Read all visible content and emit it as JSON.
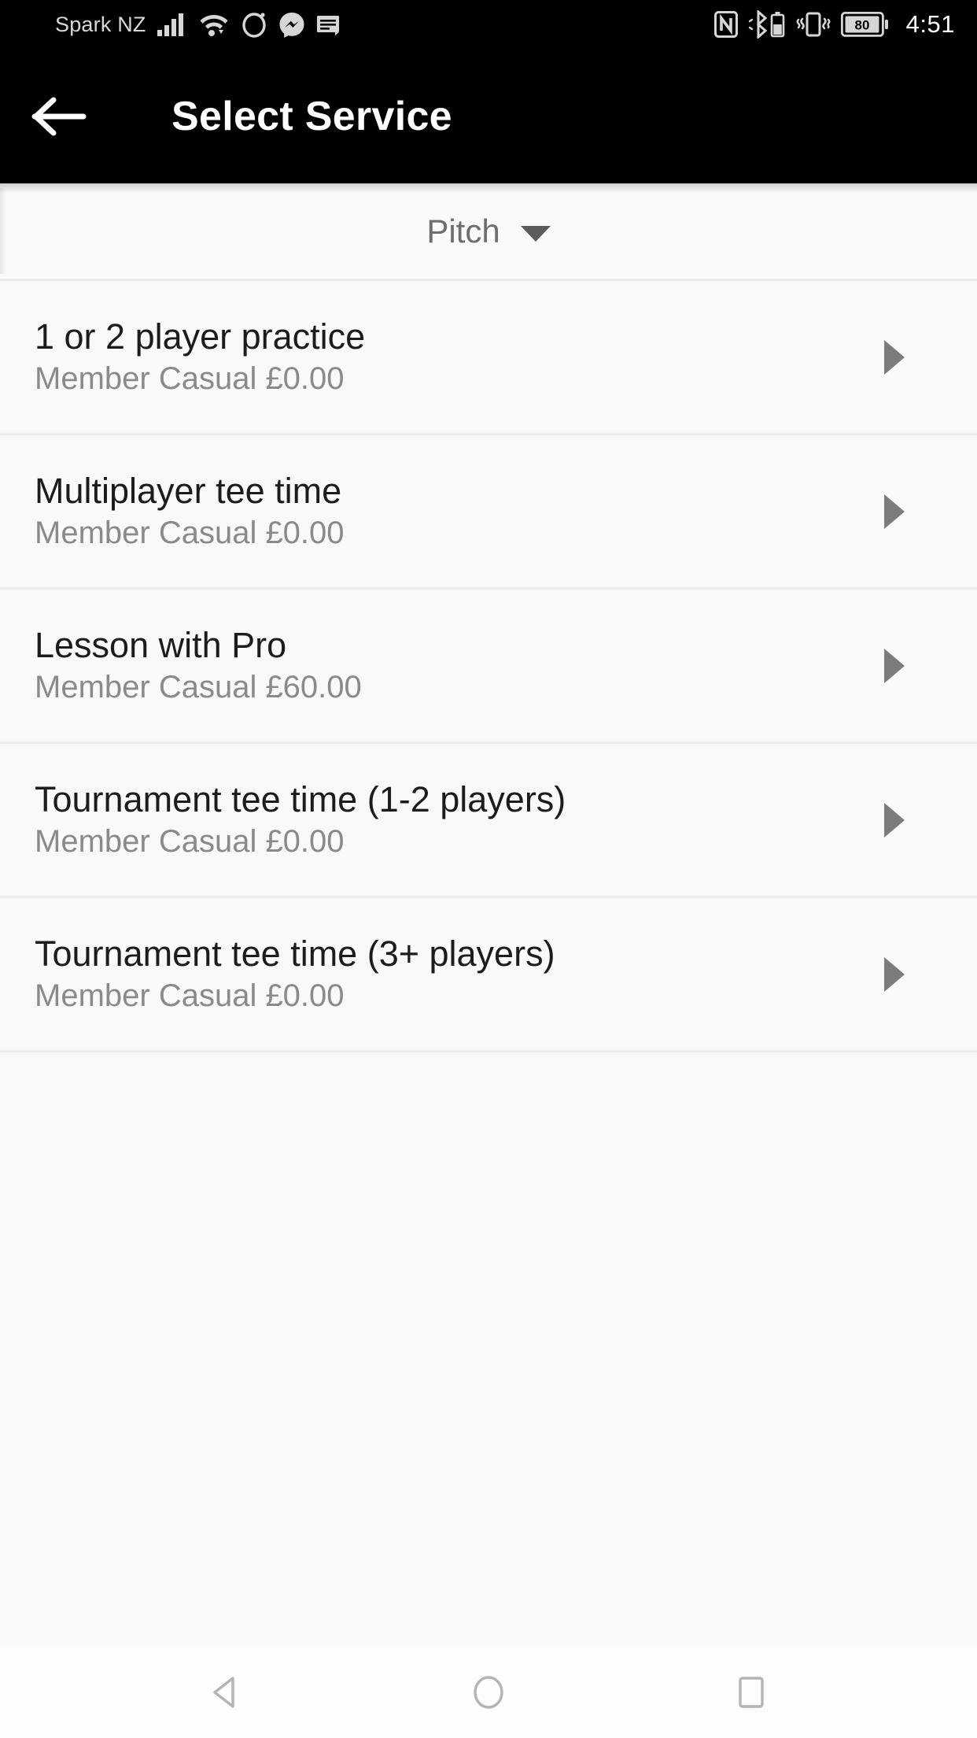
{
  "status_bar": {
    "carrier": "Spark NZ",
    "clock": "4:51",
    "battery_percent": "80",
    "icons": [
      "signal-bars-icon",
      "wifi-icon",
      "opera-icon",
      "messenger-icon",
      "notes-icon",
      "nfc-icon",
      "bluetooth-battery-icon",
      "vibrate-icon",
      "battery-icon"
    ]
  },
  "app_bar": {
    "title": "Select Service",
    "back_icon": "arrow-left-icon"
  },
  "filter": {
    "label": "Pitch",
    "caret_icon": "caret-down-icon"
  },
  "services": [
    {
      "name": "1 or 2 player practice",
      "subtitle": "Member Casual £0.00",
      "chevron_icon": "chevron-right-icon"
    },
    {
      "name": "Multiplayer tee time",
      "subtitle": "Member Casual £0.00",
      "chevron_icon": "chevron-right-icon"
    },
    {
      "name": "Lesson with Pro",
      "subtitle": "Member Casual £60.00",
      "chevron_icon": "chevron-right-icon"
    },
    {
      "name": "Tournament tee time (1-2 players)",
      "subtitle": "Member Casual £0.00",
      "chevron_icon": "chevron-right-icon"
    },
    {
      "name": "Tournament tee time (3+ players)",
      "subtitle": "Member Casual £0.00",
      "chevron_icon": "chevron-right-icon"
    }
  ],
  "nav_bar": {
    "back": "nav-back-icon",
    "home": "nav-home-icon",
    "recents": "nav-recents-icon"
  },
  "colors": {
    "app_bar_bg": "#000000",
    "page_bg": "#f9f9f9",
    "primary_text": "#1c1c1c",
    "secondary_text": "#8a8a8a",
    "divider": "#ececec"
  }
}
